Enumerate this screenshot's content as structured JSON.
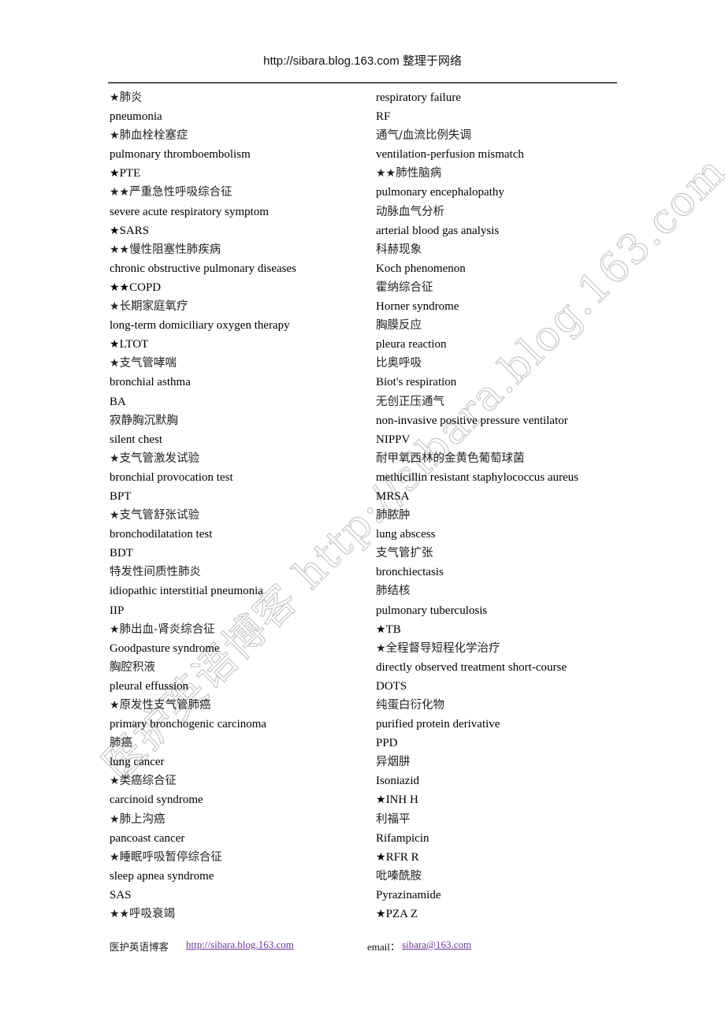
{
  "header": {
    "title": "http://sibara.blog.163.com 整理于网络"
  },
  "watermark": {
    "text": "医护英语博客 http://sibara.blog.163.com"
  },
  "columns": {
    "left": [
      {
        "stars": "★",
        "text": "肺炎",
        "lang": "zh"
      },
      {
        "stars": "",
        "text": "pneumonia",
        "lang": "en"
      },
      {
        "stars": "★",
        "text": "肺血栓栓塞症",
        "lang": "zh"
      },
      {
        "stars": "",
        "text": "pulmonary thromboembolism",
        "lang": "en"
      },
      {
        "stars": "★",
        "text": "PTE",
        "lang": "en"
      },
      {
        "stars": "★★",
        "text": "严重急性呼吸综合征",
        "lang": "zh"
      },
      {
        "stars": "",
        "text": "severe acute respiratory symptom",
        "lang": "en"
      },
      {
        "stars": "★",
        "text": "SARS",
        "lang": "en"
      },
      {
        "stars": "★★",
        "text": "慢性阻塞性肺疾病",
        "lang": "zh"
      },
      {
        "stars": "",
        "text": "chronic obstructive pulmonary diseases",
        "lang": "en"
      },
      {
        "stars": "★★",
        "text": "COPD",
        "lang": "en"
      },
      {
        "stars": "★",
        "text": "长期家庭氧疗",
        "lang": "zh"
      },
      {
        "stars": "",
        "text": "long-term domiciliary oxygen therapy",
        "lang": "en"
      },
      {
        "stars": "★",
        "text": "LTOT",
        "lang": "en"
      },
      {
        "stars": "★",
        "text": "支气管哮喘",
        "lang": "zh"
      },
      {
        "stars": "",
        "text": "bronchial asthma",
        "lang": "en"
      },
      {
        "stars": "",
        "text": "BA",
        "lang": "en"
      },
      {
        "stars": "",
        "text": "寂静胸沉默胸",
        "lang": "zh"
      },
      {
        "stars": "",
        "text": "silent chest",
        "lang": "en"
      },
      {
        "stars": "★",
        "text": "支气管激发试验",
        "lang": "zh"
      },
      {
        "stars": "",
        "text": "bronchial provocation test",
        "lang": "en"
      },
      {
        "stars": "",
        "text": "BPT",
        "lang": "en"
      },
      {
        "stars": "★",
        "text": "支气管舒张试验",
        "lang": "zh"
      },
      {
        "stars": "",
        "text": "bronchodilatation test",
        "lang": "en"
      },
      {
        "stars": "",
        "text": "BDT",
        "lang": "en"
      },
      {
        "stars": "",
        "text": "特发性间质性肺炎",
        "lang": "zh"
      },
      {
        "stars": "",
        "text": "idiopathic interstitial pneumonia",
        "lang": "en"
      },
      {
        "stars": "",
        "text": "IIP",
        "lang": "en"
      },
      {
        "stars": "★",
        "text": "肺出血-肾炎综合征",
        "lang": "zh"
      },
      {
        "stars": "",
        "text": "Goodpasture syndrome",
        "lang": "en"
      },
      {
        "stars": "",
        "text": "胸腔积液",
        "lang": "zh"
      },
      {
        "stars": "",
        "text": "pleural effussion",
        "lang": "en"
      },
      {
        "stars": "★",
        "text": "原发性支气管肺癌",
        "lang": "zh"
      },
      {
        "stars": "",
        "text": "primary bronchogenic carcinoma",
        "lang": "en"
      },
      {
        "stars": "",
        "text": "肺癌",
        "lang": "zh"
      },
      {
        "stars": "",
        "text": "lung cancer",
        "lang": "en"
      },
      {
        "stars": "★",
        "text": "类癌综合征",
        "lang": "zh"
      },
      {
        "stars": "",
        "text": "carcinoid syndrome",
        "lang": "en"
      },
      {
        "stars": "★",
        "text": "肺上沟癌",
        "lang": "zh"
      },
      {
        "stars": "",
        "text": "pancoast cancer",
        "lang": "en"
      },
      {
        "stars": "★",
        "text": "睡眠呼吸暂停综合征",
        "lang": "zh"
      },
      {
        "stars": "",
        "text": "sleep apnea syndrome",
        "lang": "en"
      },
      {
        "stars": "",
        "text": "SAS",
        "lang": "en"
      },
      {
        "stars": "★★",
        "text": "呼吸衰竭",
        "lang": "zh"
      }
    ],
    "right": [
      {
        "stars": "",
        "text": "respiratory failure",
        "lang": "en"
      },
      {
        "stars": "",
        "text": "RF",
        "lang": "en"
      },
      {
        "stars": "",
        "text": "通气/血流比例失调",
        "lang": "zh"
      },
      {
        "stars": "",
        "text": "ventilation-perfusion mismatch",
        "lang": "en"
      },
      {
        "stars": "★★",
        "text": "肺性脑病",
        "lang": "zh"
      },
      {
        "stars": "",
        "text": "pulmonary encephalopathy",
        "lang": "en"
      },
      {
        "stars": "",
        "text": "动脉血气分析",
        "lang": "zh"
      },
      {
        "stars": "",
        "text": "arterial blood gas analysis",
        "lang": "en"
      },
      {
        "stars": "",
        "text": "科赫现象",
        "lang": "zh"
      },
      {
        "stars": "",
        "text": "Koch phenomenon",
        "lang": "en"
      },
      {
        "stars": "",
        "text": "霍纳综合征",
        "lang": "zh"
      },
      {
        "stars": "",
        "text": "Horner syndrome",
        "lang": "en"
      },
      {
        "stars": "",
        "text": "胸膜反应",
        "lang": "zh"
      },
      {
        "stars": "",
        "text": "pleura reaction",
        "lang": "en"
      },
      {
        "stars": "",
        "text": "比奥呼吸",
        "lang": "zh"
      },
      {
        "stars": "",
        "text": "Biot's respiration",
        "lang": "en"
      },
      {
        "stars": "",
        "text": "无创正压通气",
        "lang": "zh"
      },
      {
        "stars": "",
        "text": "non-invasive positive pressure ventilator",
        "lang": "en"
      },
      {
        "stars": "",
        "text": "NIPPV",
        "lang": "en"
      },
      {
        "stars": "",
        "text": "耐甲氧西林的金黄色葡萄球菌",
        "lang": "zh"
      },
      {
        "stars": "",
        "text": "methicillin resistant staphylococcus aureus",
        "lang": "en"
      },
      {
        "stars": "",
        "text": "MRSA",
        "lang": "en"
      },
      {
        "stars": "",
        "text": "肺脓肿",
        "lang": "zh"
      },
      {
        "stars": "",
        "text": "lung abscess",
        "lang": "en"
      },
      {
        "stars": "",
        "text": "支气管扩张",
        "lang": "zh"
      },
      {
        "stars": "",
        "text": "bronchiectasis",
        "lang": "en"
      },
      {
        "stars": "",
        "text": "肺结核",
        "lang": "zh"
      },
      {
        "stars": "",
        "text": "pulmonary tuberculosis",
        "lang": "en"
      },
      {
        "stars": "★",
        "text": "TB",
        "lang": "en"
      },
      {
        "stars": "★",
        "text": "全程督导短程化学治疗",
        "lang": "zh"
      },
      {
        "stars": "",
        "text": "directly observed treatment short-course",
        "lang": "en"
      },
      {
        "stars": "",
        "text": "DOTS",
        "lang": "en"
      },
      {
        "stars": "",
        "text": "纯蛋白衍化物",
        "lang": "zh"
      },
      {
        "stars": "",
        "text": "purified protein derivative",
        "lang": "en"
      },
      {
        "stars": "",
        "text": "PPD",
        "lang": "en"
      },
      {
        "stars": "",
        "text": "异烟肼",
        "lang": "zh"
      },
      {
        "stars": "",
        "text": "Isoniazid",
        "lang": "en"
      },
      {
        "stars": "★",
        "text": "INH H",
        "lang": "en"
      },
      {
        "stars": "",
        "text": "利福平",
        "lang": "zh"
      },
      {
        "stars": "",
        "text": "Rifampicin",
        "lang": "en"
      },
      {
        "stars": "★",
        "text": "RFR R",
        "lang": "en"
      },
      {
        "stars": "",
        "text": "吡嗪酰胺",
        "lang": "zh"
      },
      {
        "stars": "",
        "text": "Pyrazinamide",
        "lang": "en"
      },
      {
        "stars": "★",
        "text": "PZA Z",
        "lang": "en"
      }
    ]
  },
  "footer": {
    "blog_name": "医护英语博客",
    "blog_url": "http://sibara.blog.163.com",
    "email_label": "email：",
    "email": "sibara@163.com",
    "link_color": "#7030a0"
  }
}
